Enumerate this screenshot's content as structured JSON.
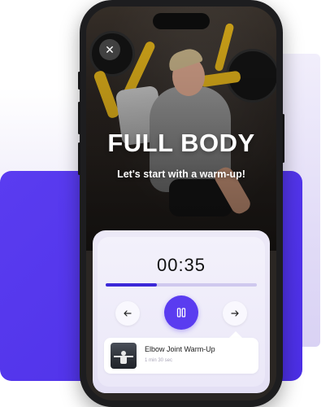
{
  "workout": {
    "title": "FULL BODY",
    "subtitle": "Let's start with a warm-up!"
  },
  "controls": {
    "close_icon": "close-icon",
    "timer": "00:35",
    "progress": 0.34,
    "prev_icon": "arrow-left-icon",
    "pause_icon": "pause-icon",
    "next_icon": "arrow-right-icon"
  },
  "exercise": {
    "name": "Elbow Joint Warm-Up",
    "duration": "1 min 30 sec"
  },
  "colors": {
    "accent": "#5a3cf0",
    "progress_fill": "#3c28d8",
    "progress_track": "#cfc8ee"
  }
}
